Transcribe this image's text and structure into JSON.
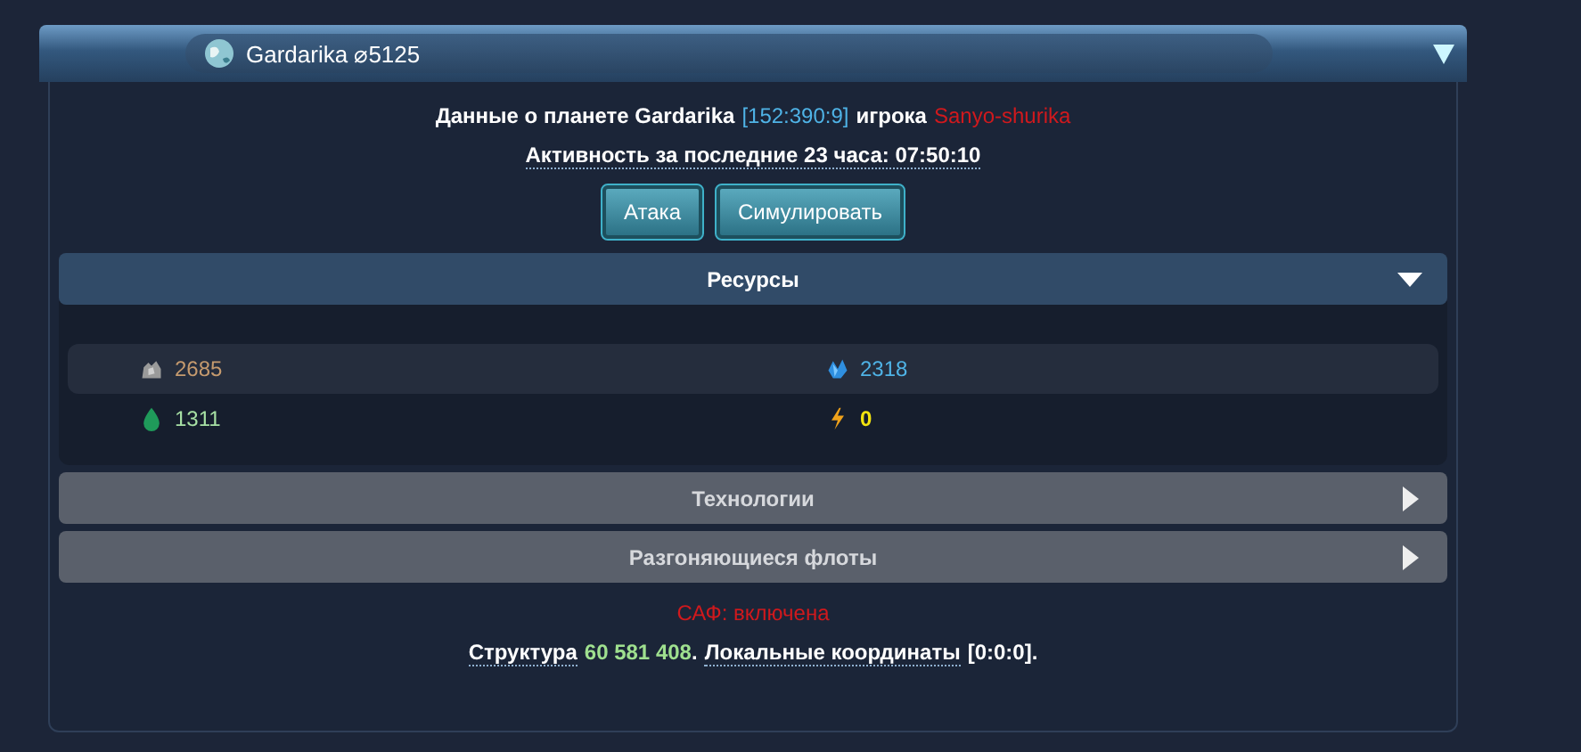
{
  "window": {
    "title": "Gardarika ⌀5125",
    "expanded": true
  },
  "info": {
    "lead": "Данные о планете Gardarika",
    "coords": "[152:390:9]",
    "owner_label": "игрока",
    "owner": "Sanyo-shurika",
    "activity": "Активность за последние 23 часа: 07:50:10"
  },
  "buttons": [
    "Атака",
    "Симулировать"
  ],
  "sections": [
    {
      "title": "Ресурсы",
      "expanded": true,
      "resources": [
        {
          "kind": "metal",
          "value": "2685",
          "color": "#c59a6e"
        },
        {
          "kind": "crystal",
          "value": "2318",
          "color": "#4fb3e6"
        },
        {
          "kind": "deuterium",
          "value": "1311",
          "color": "#a7e0a4"
        },
        {
          "kind": "energy",
          "value": "0",
          "color": "#f2e30f"
        }
      ]
    },
    {
      "title": "Технологии",
      "expanded": false
    },
    {
      "title": "Разгоняющиеся флоты",
      "expanded": false
    }
  ],
  "footer": {
    "saf": "САФ: включена",
    "structure_label": "Структура",
    "structure_value": "60 581 408",
    "sep": ".",
    "local_label": "Локальные координаты",
    "local_value": "[0:0:0]."
  }
}
